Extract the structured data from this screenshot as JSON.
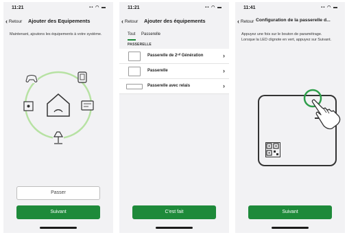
{
  "screens": [
    {
      "status_time": "11:21",
      "back_label": "Retour",
      "title": "Ajouter des Equipements",
      "description": "Maintenant, ajoutons les équipements à votre système.",
      "skip_label": "Passer",
      "next_label": "Suivant"
    },
    {
      "status_time": "11:21",
      "back_label": "Retour",
      "title": "Ajouter des équipements",
      "tabs": [
        {
          "label": "Tout",
          "active": true
        },
        {
          "label": "Passerelle",
          "active": false
        }
      ],
      "section_label": "PASSERELLE",
      "items": [
        {
          "label": "Passerelle de 2ⁿᵈ Génération"
        },
        {
          "label": "Passerelle"
        },
        {
          "label": "Passerelle avec relais"
        }
      ],
      "done_label": "C'est fait"
    },
    {
      "status_time": "11:41",
      "back_label": "Retour",
      "title": "Configuration de la passerelle d...",
      "description": "Appuyez une fois sur le bouton de paramétrage. Lorsque la LED clignote en vert, appuyez sur Suivant.",
      "next_label": "Suivant"
    }
  ],
  "colors": {
    "accent": "#1e8a3a",
    "highlight": "#2e9e4a",
    "ring": "#b7e2a3",
    "background": "#f2f2f4"
  },
  "icons": [
    "chevron-left-icon",
    "smart-home-icon",
    "gamepad-icon",
    "socket-icon",
    "thermostat-icon",
    "lamp-icon",
    "cube-icon",
    "hand-pointer-icon",
    "qr-code-icon",
    "chevron-right-icon"
  ]
}
